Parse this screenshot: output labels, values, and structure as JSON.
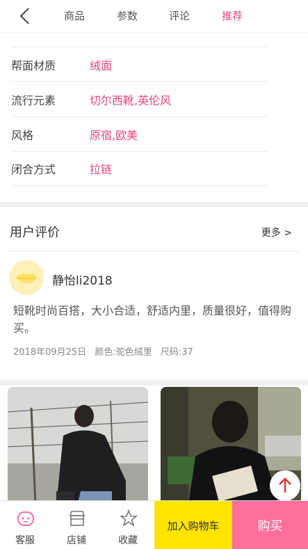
{
  "nav": {
    "tabs": [
      {
        "label": "商品",
        "active": false
      },
      {
        "label": "参数",
        "active": false
      },
      {
        "label": "评论",
        "active": false
      },
      {
        "label": "推荐",
        "active": true
      }
    ],
    "accent": "#e8457a"
  },
  "specs": [
    {
      "label": "帮面材质",
      "value": "绒面"
    },
    {
      "label": "流行元素",
      "value": "切尔西靴,英伦风"
    },
    {
      "label": "风格",
      "value": "原宿,欧美"
    },
    {
      "label": "闭合方式",
      "value": "拉链"
    }
  ],
  "reviews": {
    "title": "用户评价",
    "more": "更多 >",
    "item": {
      "username": "静怡li2018",
      "text": "短靴时尚百搭，大小合适，舒适内里，质量很好，值得购买。",
      "date": "2018年09月25日",
      "color": "颜色:驼色绒里",
      "size": "尺码:37"
    }
  },
  "bottom": {
    "service": "客服",
    "shop": "店铺",
    "favorite": "收藏",
    "add_cart": "加入购物车",
    "buy": "购买",
    "cart_color": "#ffe400",
    "buy_color": "#ff6f9c"
  }
}
